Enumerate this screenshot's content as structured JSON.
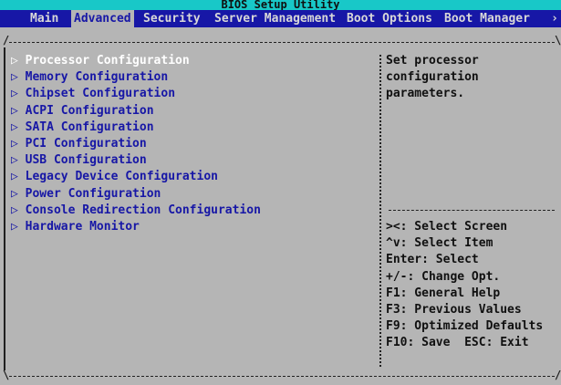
{
  "app_title": "BIOS Setup Utility",
  "tabs": [
    {
      "label": "Main",
      "active": false
    },
    {
      "label": "Advanced",
      "active": true
    },
    {
      "label": "Security",
      "active": false
    },
    {
      "label": "Server Management",
      "active": false
    },
    {
      "label": "Boot Options",
      "active": false
    },
    {
      "label": "Boot Manager",
      "active": false
    }
  ],
  "menu_arrow": "›",
  "menu_items": [
    {
      "label": "Processor Configuration",
      "selected": true
    },
    {
      "label": "Memory Configuration",
      "selected": false
    },
    {
      "label": "Chipset Configuration",
      "selected": false
    },
    {
      "label": "ACPI Configuration",
      "selected": false
    },
    {
      "label": "SATA Configuration",
      "selected": false
    },
    {
      "label": "PCI Configuration",
      "selected": false
    },
    {
      "label": "USB Configuration",
      "selected": false
    },
    {
      "label": "Legacy Device Configuration",
      "selected": false
    },
    {
      "label": "Power Configuration",
      "selected": false
    },
    {
      "label": "Console Redirection Configuration",
      "selected": false
    },
    {
      "label": "Hardware Monitor",
      "selected": false
    }
  ],
  "item_marker": "▷",
  "help_text": [
    "Set processor",
    "configuration",
    "parameters."
  ],
  "key_help": [
    "><: Select Screen",
    "^v: Select Item",
    "Enter: Select",
    "+/-: Change Opt.",
    "F1: General Help",
    "F3: Previous Values",
    "F9: Optimized Defaults",
    "F10: Save  ESC: Exit"
  ],
  "colors": {
    "background": "#b5b5b5",
    "title_bar": "#18c8c8",
    "menu_bar": "#1717a6",
    "item_text": "#1717a6",
    "selected_text": "#ffffff"
  }
}
